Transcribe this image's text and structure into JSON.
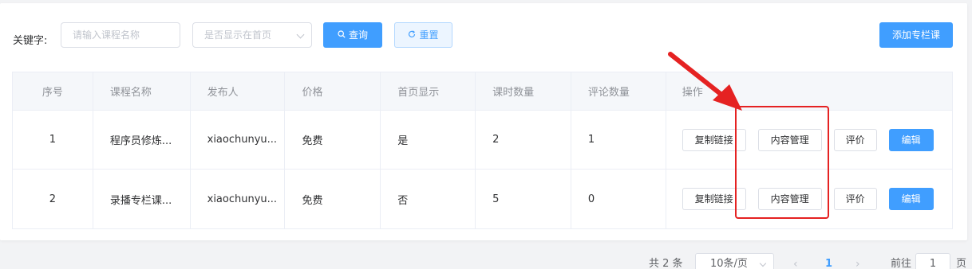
{
  "filters": {
    "keyword_label": "关键字:",
    "name_placeholder": "请输入课程名称",
    "homepage_select_placeholder": "是否显示在首页",
    "query_label": "查询",
    "reset_label": "重置",
    "add_label": "添加专栏课"
  },
  "table": {
    "columns": [
      "序号",
      "课程名称",
      "发布人",
      "价格",
      "首页显示",
      "课时数量",
      "评论数量",
      "操作"
    ],
    "rows": [
      {
        "index": "1",
        "name": "程序员修炼...",
        "publisher": "xiaochunyu...",
        "price": "免费",
        "homepage": "是",
        "lessons": "2",
        "comments": "1"
      },
      {
        "index": "2",
        "name": "录播专栏课...",
        "publisher": "xiaochunyu...",
        "price": "免费",
        "homepage": "否",
        "lessons": "5",
        "comments": "0"
      }
    ],
    "actions": {
      "copy_link": "复制链接",
      "content_manage": "内容管理",
      "review": "评价",
      "edit": "编辑"
    }
  },
  "pagination": {
    "total_text": "共 2 条",
    "page_size": "10条/页",
    "current_page": "1",
    "goto_label": "前往",
    "goto_value": "1",
    "page_suffix": "页"
  },
  "colors": {
    "primary": "#409eff",
    "annotation_red": "#e52222"
  },
  "icons": {
    "query": "search-icon",
    "reset": "refresh-icon"
  }
}
